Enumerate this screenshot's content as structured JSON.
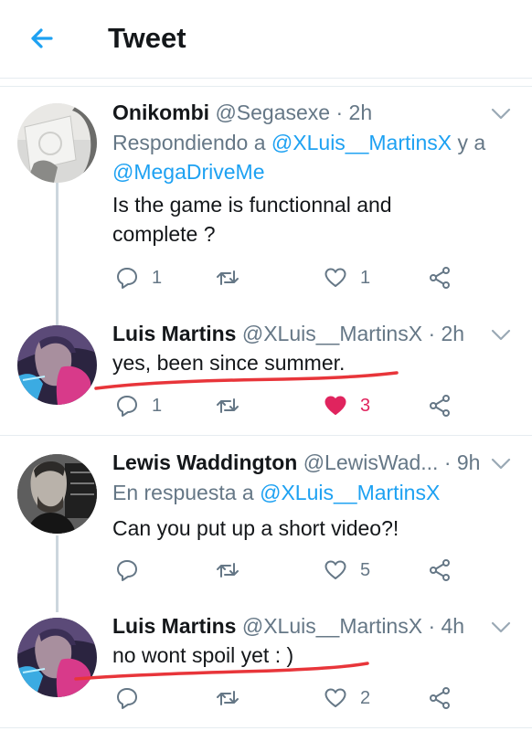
{
  "header": {
    "title": "Tweet"
  },
  "tweets": [
    {
      "name": "Onikombi",
      "meta": "@Segasexe · 2h",
      "reply_prefix": "Respondiendo a ",
      "reply_handle_1": "@XLuis__MartinsX",
      "reply_joiner": " y a",
      "reply_handle_2": "@MegaDriveMe",
      "text_line_1": "Is the game is functionnal and",
      "text_line_2": "complete ?",
      "reply_count": "1",
      "retweet_count": "",
      "like_count": "1"
    },
    {
      "name": "Luis Martins",
      "meta": "@XLuis__MartinsX · 2h",
      "text": "yes, been since summer.",
      "reply_count": "1",
      "retweet_count": "",
      "like_count": "3",
      "liked": true
    },
    {
      "name": "Lewis Waddington",
      "meta": "@LewisWad... · 9h",
      "reply_prefix": "En respuesta a ",
      "reply_handle_1": "@XLuis__MartinsX",
      "text": "Can you put up a short video?!",
      "reply_count": "",
      "retweet_count": "",
      "like_count": "5"
    },
    {
      "name": "Luis Martins",
      "meta": "@XLuis__MartinsX · 4h",
      "text": "no wont spoil yet : )",
      "reply_count": "",
      "retweet_count": "",
      "like_count": "2"
    }
  ],
  "colors": {
    "accent": "#1da1f2",
    "secondary_text": "#657786",
    "like_red": "#e0245e",
    "annotation_red": "#e8353a"
  },
  "icons": [
    "back-arrow-icon",
    "chevron-down-icon",
    "reply-icon",
    "retweet-icon",
    "heart-icon",
    "share-icon"
  ]
}
